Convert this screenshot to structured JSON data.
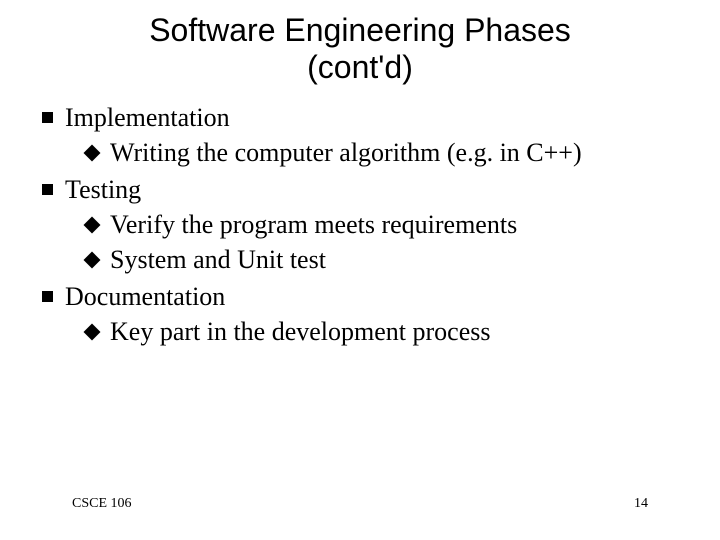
{
  "title_line1": "Software Engineering Phases",
  "title_line2": "(cont'd)",
  "items": [
    {
      "label": "Implementation",
      "sub": [
        "Writing the computer algorithm (e.g. in C++)"
      ]
    },
    {
      "label": "Testing",
      "sub": [
        "Verify the program meets requirements",
        "System and Unit test"
      ]
    },
    {
      "label": "Documentation",
      "sub": [
        "Key part in the development process"
      ]
    }
  ],
  "footer_left": "CSCE 106",
  "footer_right": "14"
}
